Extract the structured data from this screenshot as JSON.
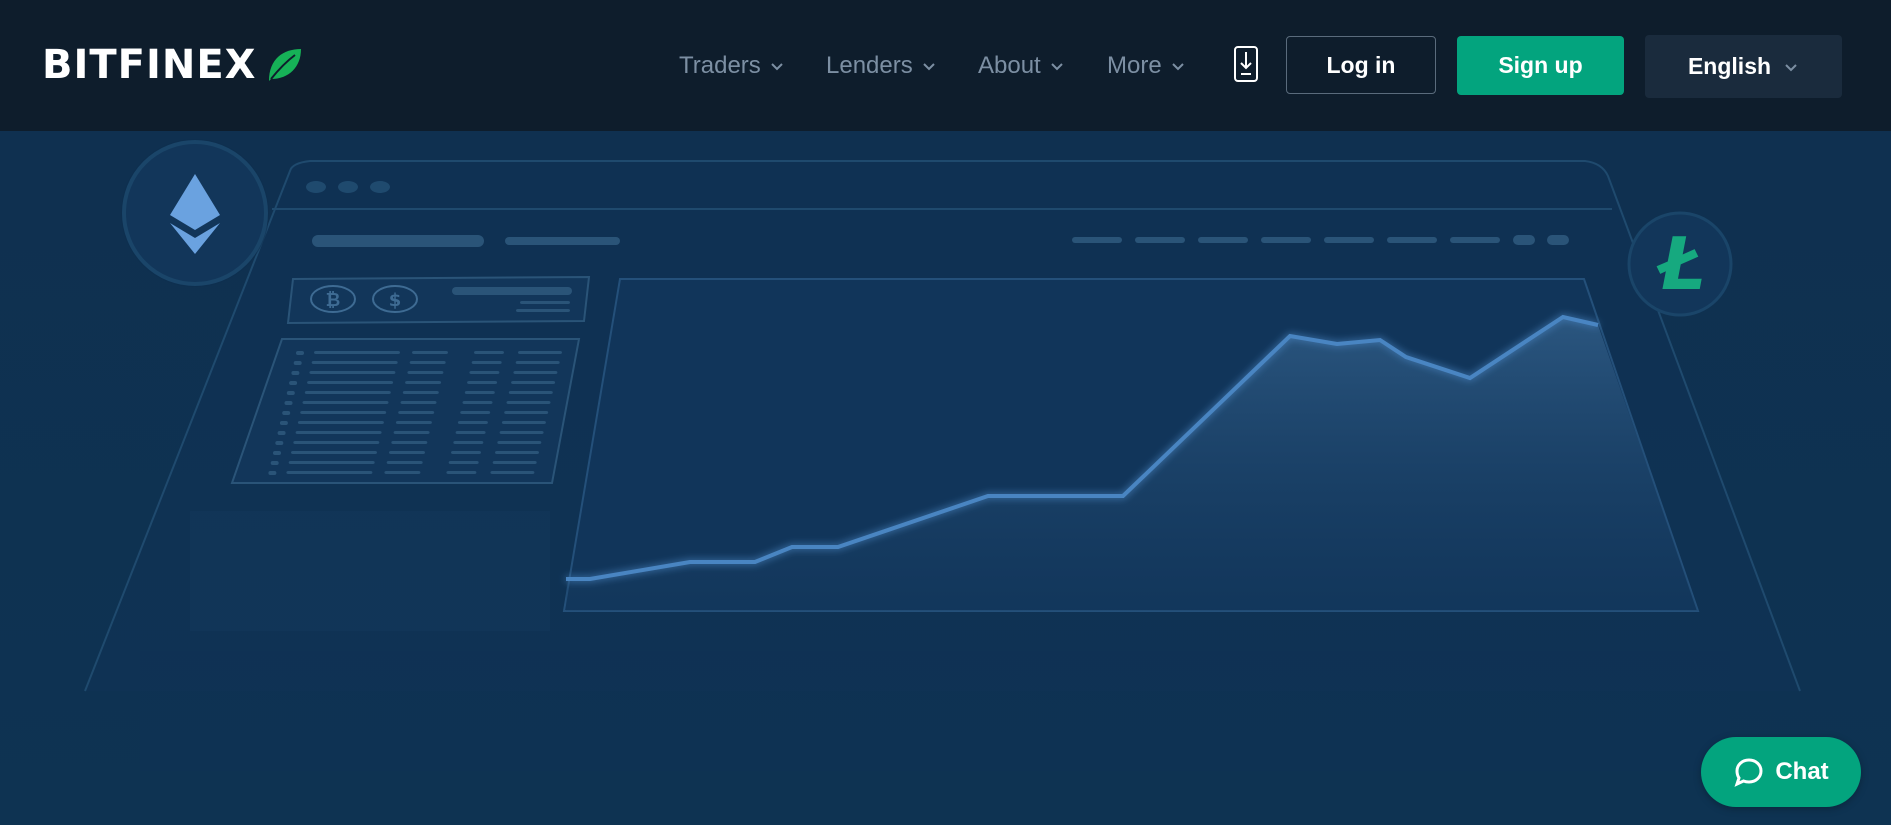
{
  "brand": {
    "name": "BITFINEX",
    "logo_icon": "leaf-icon",
    "accent": "#03a47e"
  },
  "nav": {
    "items": [
      {
        "label": "Traders",
        "icon": "chevron-down-icon"
      },
      {
        "label": "Lenders",
        "icon": "chevron-down-icon"
      },
      {
        "label": "About",
        "icon": "chevron-down-icon"
      },
      {
        "label": "More",
        "icon": "chevron-down-icon"
      }
    ],
    "download_icon": "mobile-download-icon",
    "login_label": "Log in",
    "signup_label": "Sign up",
    "language_label": "English"
  },
  "hero": {
    "coins": [
      "ethereum-icon",
      "litecoin-icon",
      "bitcoin-icon",
      "dollar-icon"
    ]
  },
  "chat": {
    "label": "Chat",
    "icon": "chat-bubble-icon"
  },
  "colors": {
    "navbar_bg": "#0e1d2c",
    "hero_bg": "#0f3050",
    "primary_green": "#03a47e",
    "language_bg": "#1a2b3d"
  }
}
